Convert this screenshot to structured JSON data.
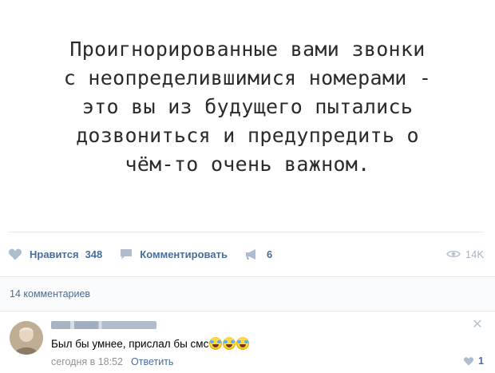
{
  "post": {
    "quote_lines": [
      "Проигнорированные вами звонки",
      "с неопределившимися номерами -",
      "это вы из будущего пытались",
      "дозвониться и предупредить о",
      "чём-то очень важном."
    ]
  },
  "actions": {
    "like_label": "Нравится",
    "like_count": "348",
    "comment_label": "Комментировать",
    "share_count": "6",
    "views": "14K"
  },
  "comments": {
    "count_label": "14 комментариев",
    "items": [
      {
        "text": "Был бы умнее, прислал бы смс",
        "emoji": [
          "tears-of-joy",
          "tears-of-joy",
          "tears-of-joy"
        ],
        "time": "сегодня в 18:52",
        "reply_label": "Ответить",
        "likes": "1"
      }
    ]
  },
  "colors": {
    "accent": "#4a6e99",
    "muted": "#939393",
    "divider": "#e7e8ec"
  }
}
